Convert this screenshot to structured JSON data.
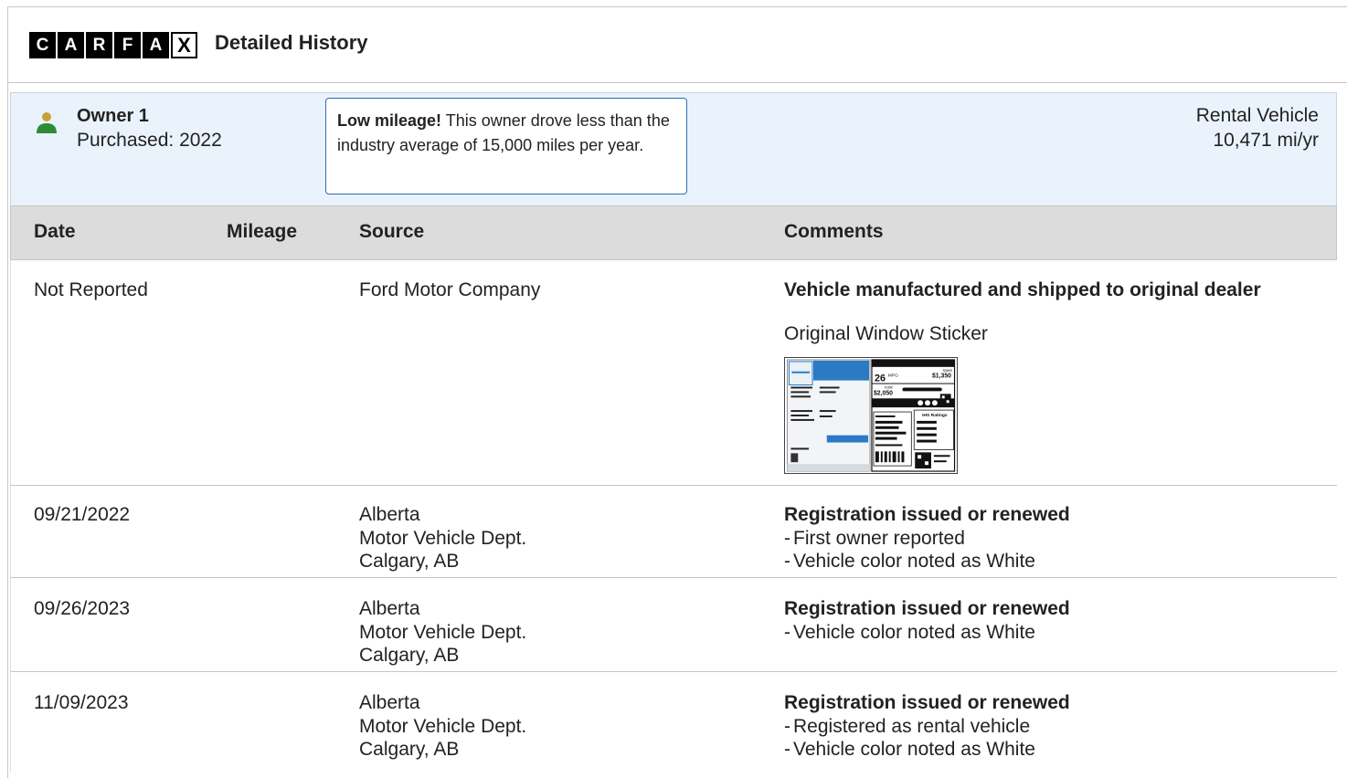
{
  "header": {
    "logo_letters": [
      "C",
      "A",
      "R",
      "F",
      "A",
      "X"
    ],
    "title": "Detailed History"
  },
  "owner": {
    "name": "Owner 1",
    "purchased": "Purchased: 2022",
    "callout_bold": "Low mileage!",
    "callout_text": " This owner drove less than the industry average of 15,000 miles per year.",
    "type": "Rental Vehicle",
    "mileage": "10,471 mi/yr"
  },
  "table": {
    "headers": {
      "date": "Date",
      "mileage": "Mileage",
      "source": "Source",
      "comments": "Comments"
    },
    "rows": [
      {
        "date": "Not Reported",
        "mileage": "",
        "source": [
          "Ford Motor Company"
        ],
        "comment_title": "Vehicle manufactured and shipped to original dealer",
        "comment_plain": "Original Window Sticker",
        "comment_items": []
      },
      {
        "date": "09/21/2022",
        "mileage": "",
        "source": [
          "Alberta",
          "Motor Vehicle Dept.",
          "Calgary, AB"
        ],
        "comment_title": "Registration issued or renewed",
        "comment_items": [
          "First owner reported",
          "Vehicle color noted as White"
        ]
      },
      {
        "date": "09/26/2023",
        "mileage": "",
        "source": [
          "Alberta",
          "Motor Vehicle Dept.",
          "Calgary, AB"
        ],
        "comment_title": "Registration issued or renewed",
        "comment_items": [
          "Vehicle color noted as White"
        ]
      },
      {
        "date": "11/09/2023",
        "mileage": "",
        "source": [
          "Alberta",
          "Motor Vehicle Dept.",
          "Calgary, AB"
        ],
        "comment_title": "Registration issued or renewed",
        "comment_items": [
          "Registered as rental vehicle",
          "Vehicle color noted as White"
        ]
      }
    ]
  },
  "sticker": {
    "mpg": "26",
    "mpg_unit": "MPG",
    "save_label": "save",
    "save_amount": "$1,350",
    "cost_label": "cost",
    "cost_amount": "$2,050",
    "ratings_label": "IHS Ratings"
  },
  "colors": {
    "owner_icon_head": "#c8a13a",
    "owner_icon_body": "#2e8b3a",
    "callout_border": "#2b6cb0",
    "panel_bg": "#eaf3fb"
  },
  "icons": {
    "owner": "person-icon",
    "sticker": "window-sticker-thumbnail"
  }
}
